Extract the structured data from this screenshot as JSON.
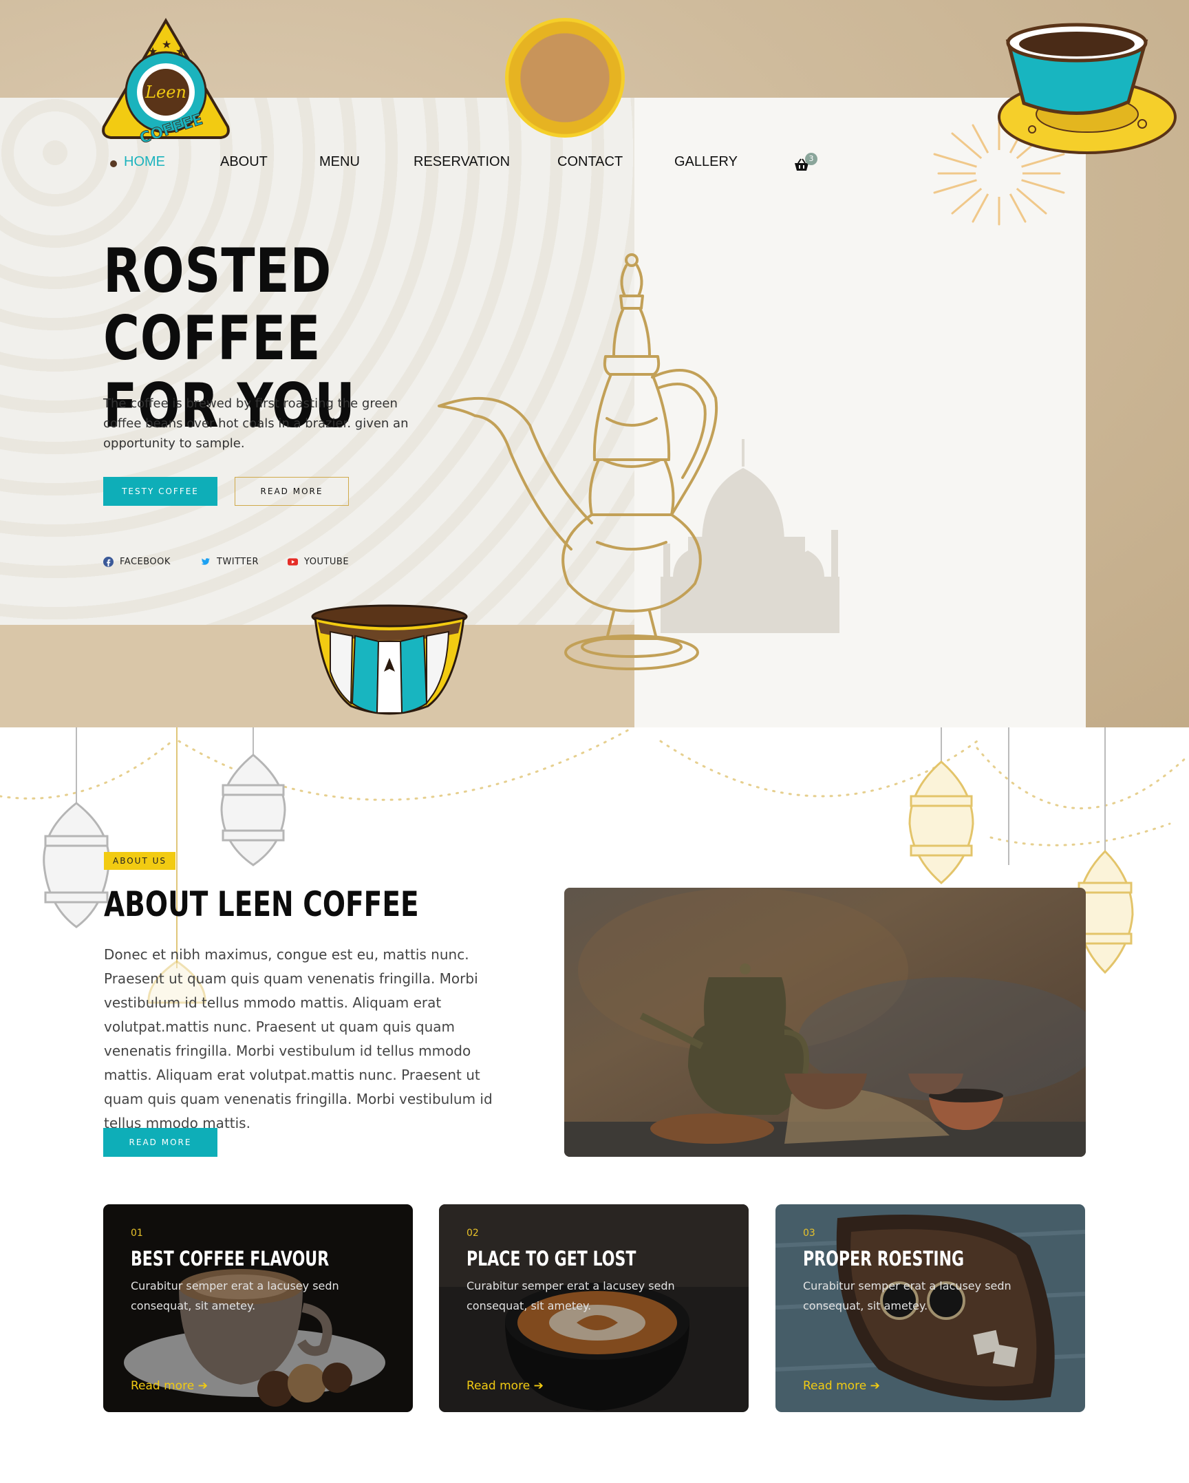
{
  "brand": {
    "logo_text": "Leen",
    "logo_subtext": "COFFEE"
  },
  "nav": {
    "items": [
      {
        "label": "HOME",
        "active": true
      },
      {
        "label": "ABOUT"
      },
      {
        "label": "MENU"
      },
      {
        "label": "RESERVATION"
      },
      {
        "label": "CONTACT"
      },
      {
        "label": "GALLERY"
      }
    ],
    "cart_icon": "basket-icon",
    "cart_count": "3"
  },
  "hero": {
    "title_line1": "ROSTED COFFEE",
    "title_line2": "FOR YOU",
    "text": "The coffee is brewed by first roasting the green coffee beans over hot coals in a brazier. given an opportunity to sample.",
    "primary_button": "TESTY COFFEE",
    "secondary_button": "READ MORE",
    "socials": [
      {
        "label": "FACEBOOK",
        "icon": "facebook-icon",
        "color": "#3b5998"
      },
      {
        "label": "TWITTER",
        "icon": "twitter-icon",
        "color": "#1da1f2"
      },
      {
        "label": "YOUTUBE",
        "icon": "youtube-icon",
        "color": "#e52d27"
      }
    ]
  },
  "about": {
    "badge": "ABOUT US",
    "title": "ABOUT LEEN COFFEE",
    "text": "Donec et nibh maximus, congue est eu, mattis nunc. Praesent ut quam quis quam venenatis fringilla. Morbi vestibulum id tellus mmodo mattis. Aliquam erat volutpat.mattis nunc. Praesent ut quam quis quam venenatis fringilla. Morbi vestibulum id tellus mmodo mattis. Aliquam erat volutpat.mattis nunc. Praesent ut quam quis quam venenatis fringilla. Morbi vestibulum id tellus mmodo mattis.",
    "button": "READ MORE"
  },
  "features": [
    {
      "num": "01",
      "title": "BEST COFFEE FLAVOUR",
      "text": "Curabitur semper erat a lacusey sedn consequat, sit ametey.",
      "link": "Read more"
    },
    {
      "num": "02",
      "title": "PLACE TO GET LOST",
      "text": "Curabitur semper erat a lacusey sedn consequat, sit ametey.",
      "link": "Read more"
    },
    {
      "num": "03",
      "title": "PROPER ROESTING",
      "text": "Curabitur semper erat a lacusey sedn consequat, sit ametey.",
      "link": "Read more"
    }
  ],
  "colors": {
    "accent_teal": "#0eaeb8",
    "accent_yellow": "#f2cb12",
    "gold": "#c9a650",
    "dark": "#0c0c0c"
  }
}
